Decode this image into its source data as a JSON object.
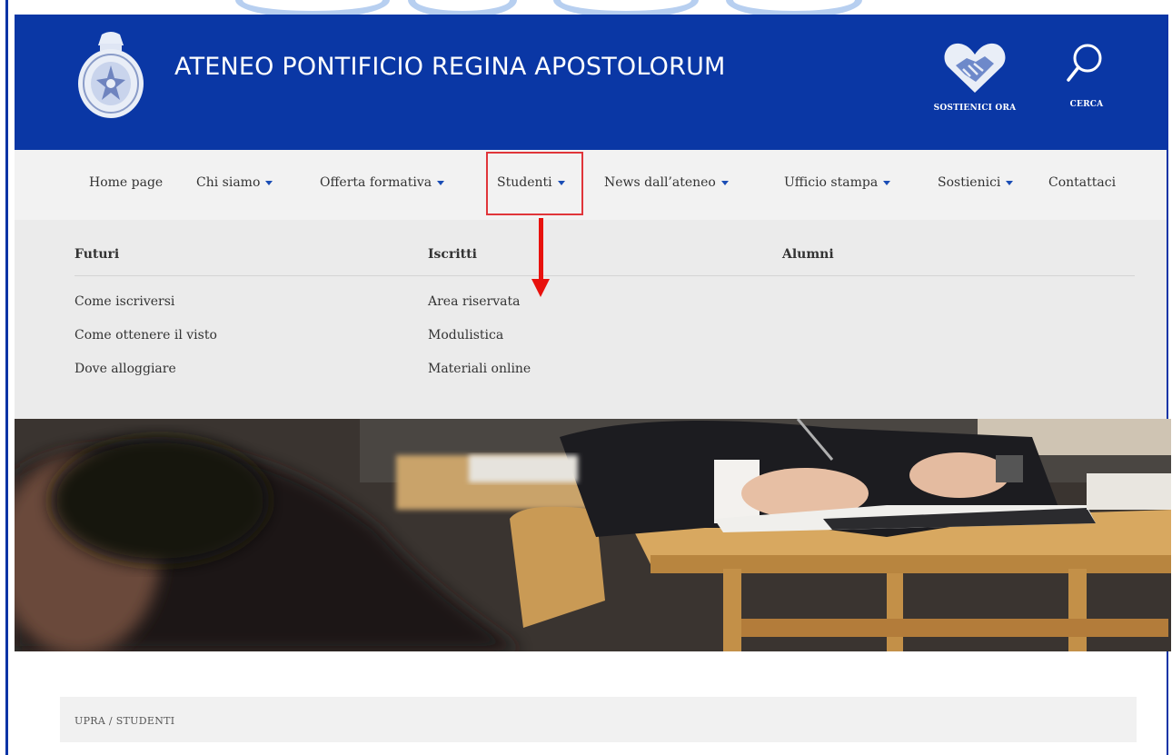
{
  "header": {
    "title": "ATENEO PONTIFICIO REGINA APOSTOLORUM",
    "support_label": "SOSTIENICI ORA",
    "search_label": "CERCA",
    "logo_icon": "university-seal-icon",
    "support_icon": "heart-handshake-icon",
    "search_icon": "magnifier-icon",
    "background_color": "#0a37a5"
  },
  "nav": {
    "items": [
      {
        "label": "Home page",
        "has_dropdown": false
      },
      {
        "label": "Chi siamo",
        "has_dropdown": true
      },
      {
        "label": "Offerta formativa",
        "has_dropdown": true
      },
      {
        "label": "Studenti",
        "has_dropdown": true
      },
      {
        "label": "News dall’ateneo",
        "has_dropdown": true
      },
      {
        "label": "Ufficio stampa",
        "has_dropdown": true
      },
      {
        "label": "Sostienici",
        "has_dropdown": true
      },
      {
        "label": "Contattaci",
        "has_dropdown": false
      }
    ]
  },
  "dropdown": {
    "columns": [
      {
        "heading": "Futuri",
        "links": [
          "Come iscriversi",
          "Come ottenere il visto",
          "Dove alloggiare"
        ]
      },
      {
        "heading": "Iscritti",
        "links": [
          "Area riservata",
          "Modulistica",
          "Materiali online"
        ]
      },
      {
        "heading": "Alumni",
        "links": []
      }
    ]
  },
  "annotation": {
    "highlight_color": "#e0353a",
    "arrow_color": "#e8110d"
  },
  "breadcrumb": {
    "text": "UPRA / STUDENTI"
  }
}
